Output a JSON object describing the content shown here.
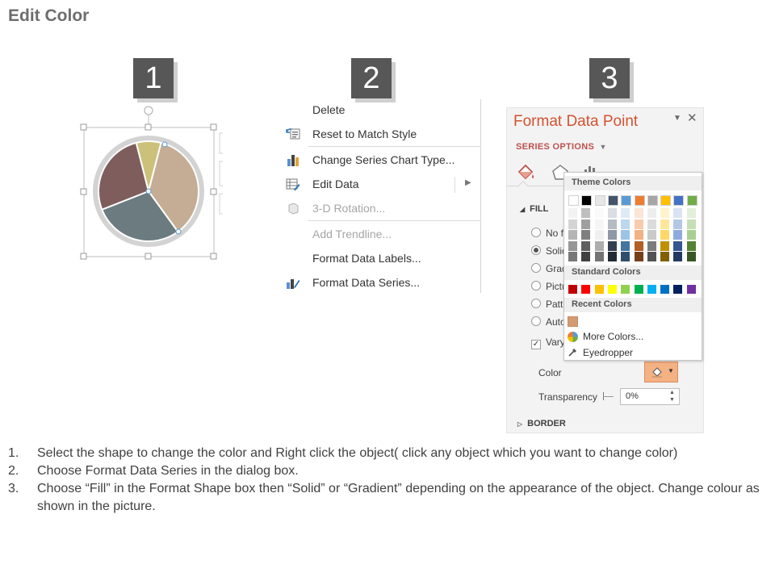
{
  "title": "Edit Color",
  "steps": [
    "1",
    "2",
    "3"
  ],
  "context_menu": {
    "items": [
      {
        "label": "Delete",
        "disabled": false
      },
      {
        "label": "Reset to Match Style",
        "disabled": false
      },
      {
        "label": "Change Series Chart Type...",
        "disabled": false
      },
      {
        "label": "Edit Data",
        "disabled": false
      },
      {
        "label": "3-D Rotation...",
        "disabled": true
      },
      {
        "label": "Add Trendline...",
        "disabled": true
      },
      {
        "label": "Format Data Labels...",
        "disabled": false
      },
      {
        "label": "Format Data Series...",
        "disabled": false
      }
    ]
  },
  "format_pane": {
    "title": "Format Data Point",
    "series_options": "SERIES OPTIONS",
    "fill_header": "FILL",
    "fill_options": [
      "No f",
      "Solic",
      "Grad",
      "Pictu",
      "Patte",
      "Auto"
    ],
    "selected_fill": "Solic",
    "vary_label": "Vary",
    "color_label": "Color",
    "transparency_label": "Transparency",
    "transparency_value": "0%",
    "border_header": "BORDER"
  },
  "color_dropdown": {
    "theme_colors_label": "Theme Colors",
    "standard_colors_label": "Standard Colors",
    "recent_colors_label": "Recent Colors",
    "more_colors_label": "More Colors...",
    "eyedropper_label": "Eyedropper",
    "theme_colors": [
      "#ffffff",
      "#000000",
      "#e7e6e6",
      "#44546a",
      "#5b9bd5",
      "#ed7d31",
      "#a5a5a5",
      "#ffc000",
      "#4472c4",
      "#70ad47"
    ],
    "standard_colors": [
      "#c00000",
      "#ff0000",
      "#ffc000",
      "#ffff00",
      "#92d050",
      "#00b050",
      "#00b0f0",
      "#0070c0",
      "#002060",
      "#7030a0"
    ],
    "recent_color": "#d29c74"
  },
  "pie_colors": [
    "#cbc17a",
    "#c4ad94",
    "#6b7b80",
    "#7f5d5d"
  ],
  "pie_values": [
    8,
    36,
    29,
    27
  ],
  "instructions": [
    {
      "num": "1.",
      "text": "Select the shape to change the color and Right click the object( click any object which you want to change color)"
    },
    {
      "num": "2.",
      "text": "Choose Format Data Series in the dialog box."
    },
    {
      "num": "3.",
      "text": "Choose “Fill” in the Format Shape box then “Solid” or “Gradient” depending on the appearance of the object. Change colour as shown in the picture."
    }
  ]
}
